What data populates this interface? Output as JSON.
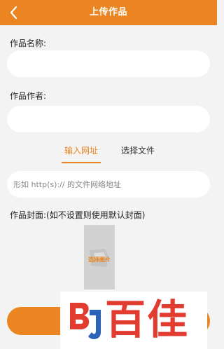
{
  "header": {
    "title": "上传作品",
    "back_icon": "chevron-left-icon",
    "background": "#ea8521"
  },
  "form": {
    "name_label": "作品名称:",
    "name_value": "",
    "author_label": "作品作者:",
    "author_value": ""
  },
  "tabs": [
    {
      "label": "输入网址",
      "active": true
    },
    {
      "label": "选择文件",
      "active": false
    }
  ],
  "url_input": {
    "placeholder": "形如 http(s):// 的文件网络地址",
    "value": ""
  },
  "cover": {
    "label": "作品封面:(如不设置则使用默认封面)",
    "select_text": "选择图片"
  },
  "submit": {
    "label": ""
  },
  "watermark": {
    "text": "百佳",
    "logo_icon": "bj-logo-icon",
    "color": "#e23b2f"
  },
  "colors": {
    "accent": "#ea8521",
    "background": "#f3f3f3"
  }
}
